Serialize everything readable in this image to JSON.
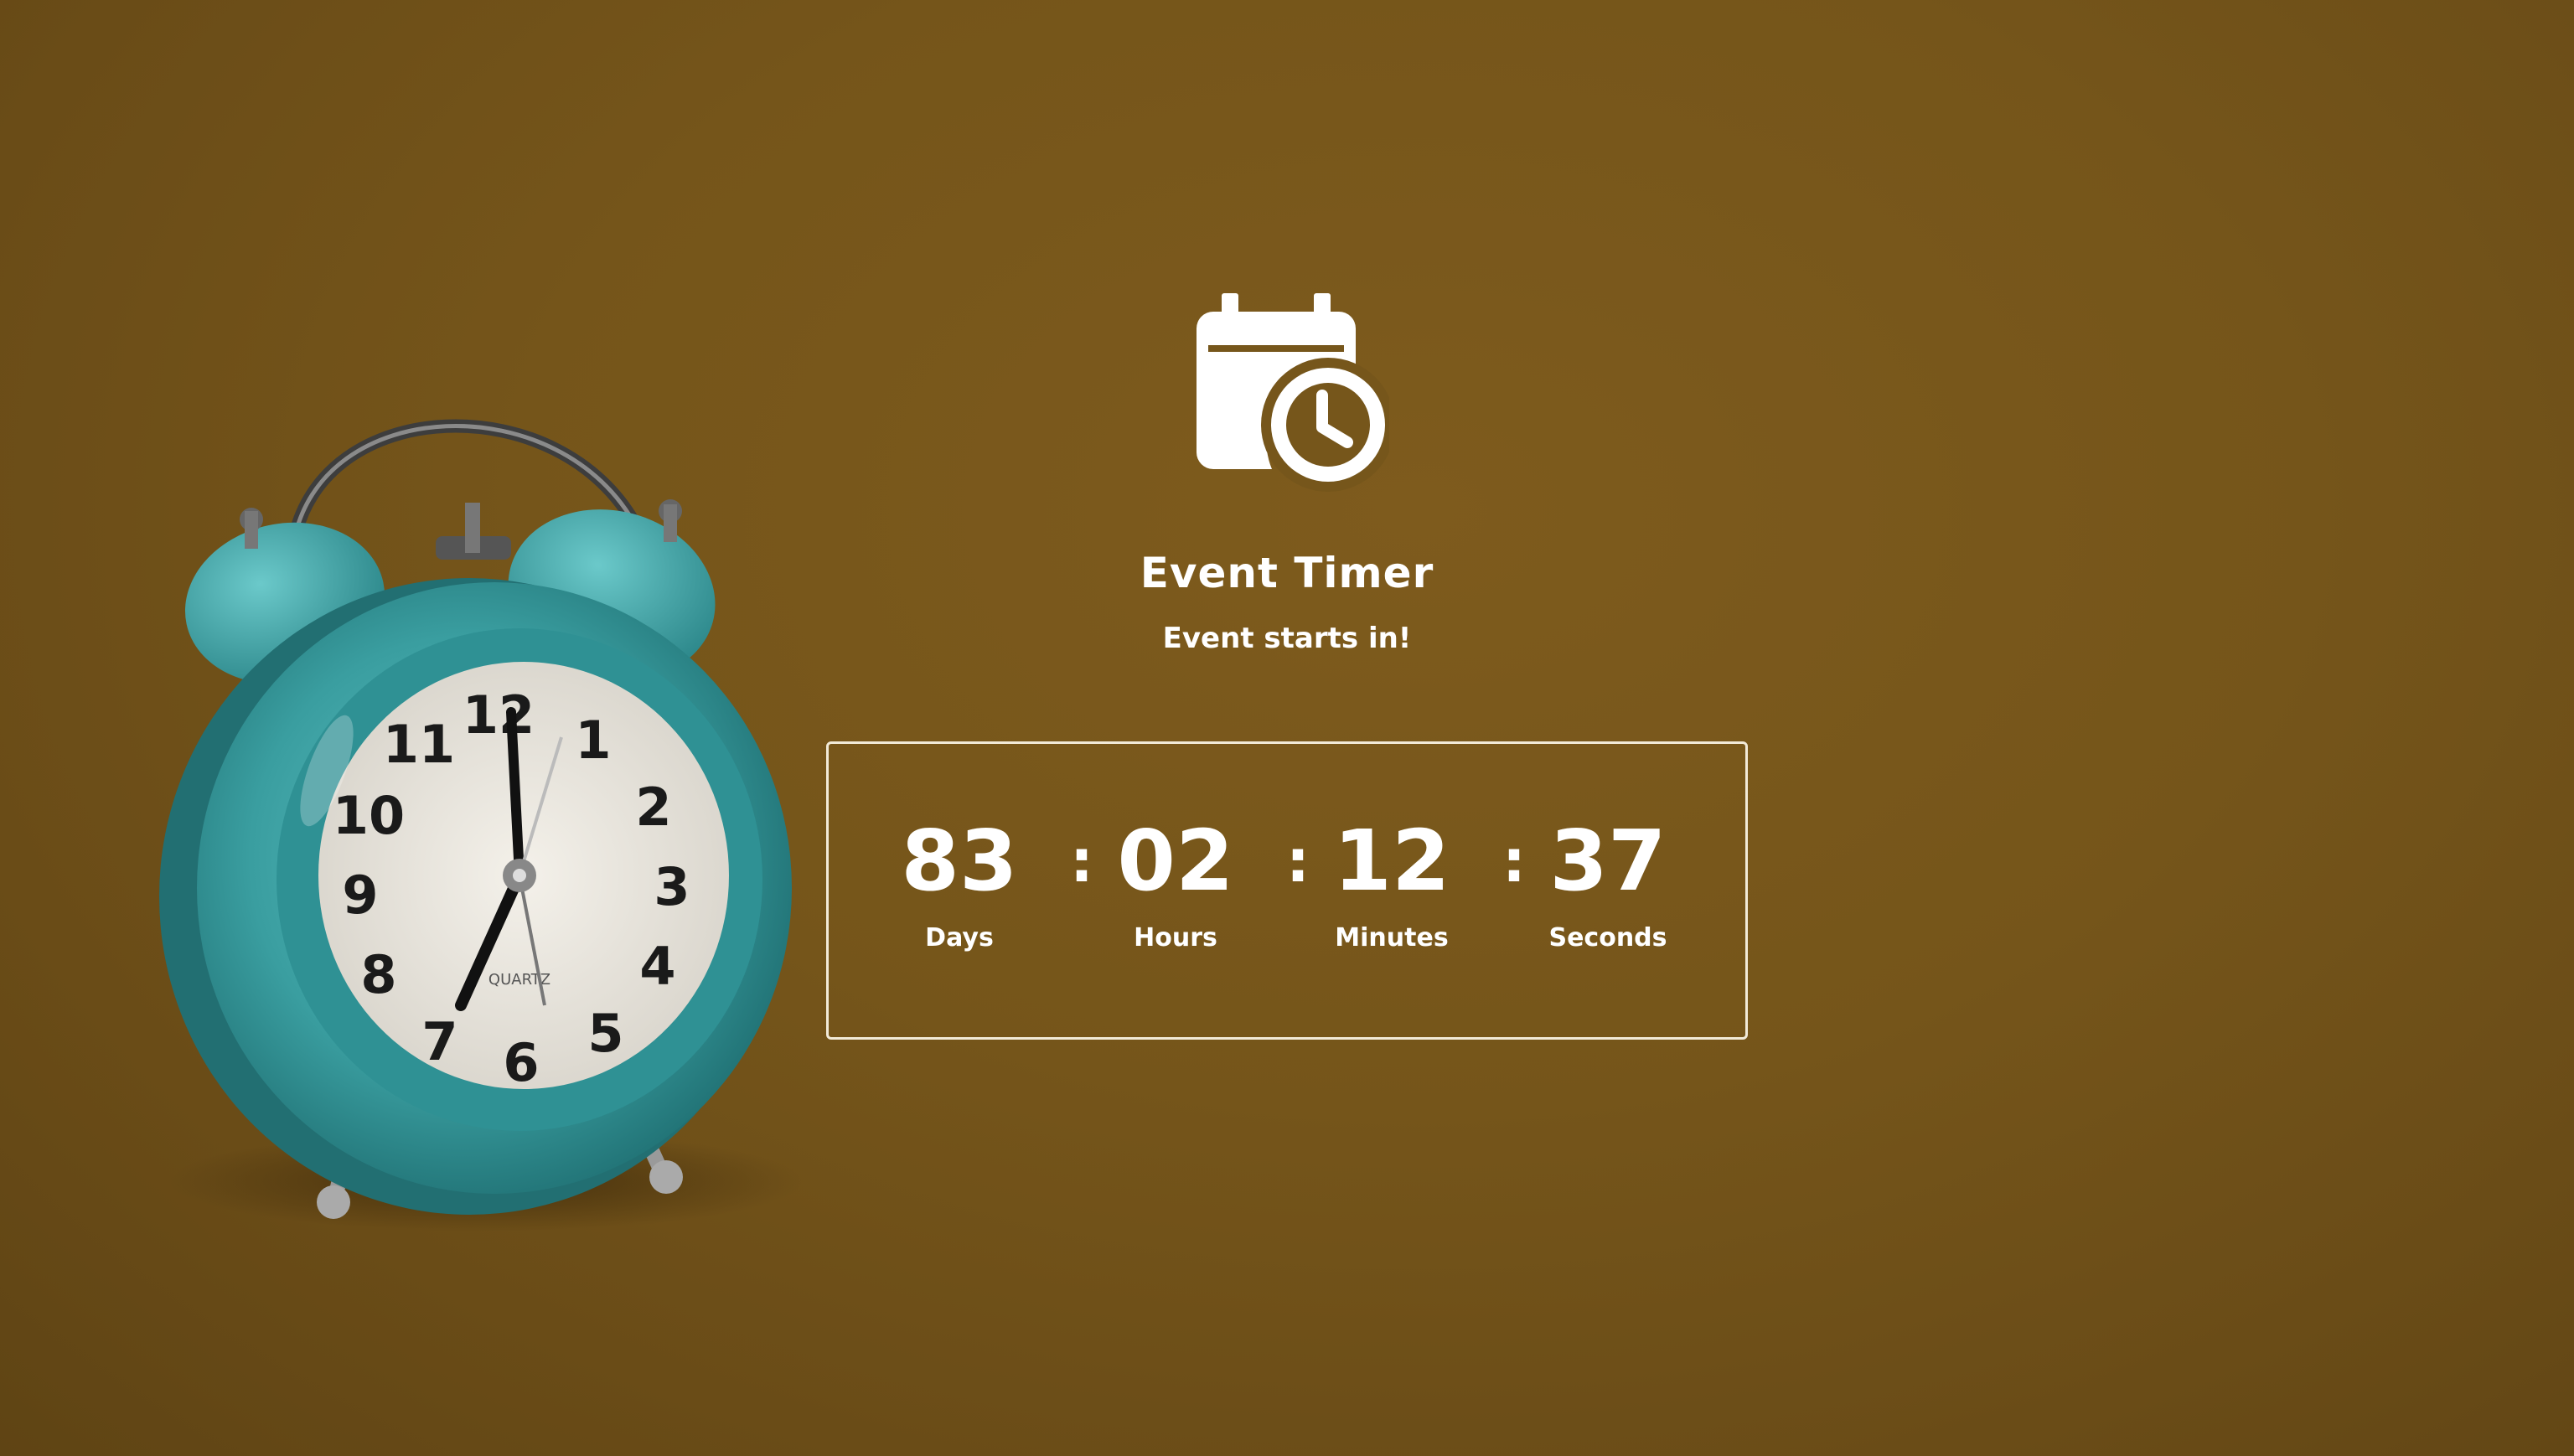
{
  "header": {
    "icon": "calendar-clock-icon",
    "title": "Event Timer",
    "subtitle": "Event starts in!"
  },
  "countdown": {
    "separator": ":",
    "days": {
      "value": "83",
      "label": "Days"
    },
    "hours": {
      "value": "02",
      "label": "Hours"
    },
    "minutes": {
      "value": "12",
      "label": "Minutes"
    },
    "seconds": {
      "value": "37",
      "label": "Seconds"
    }
  },
  "background": {
    "image": "teal-alarm-clock",
    "clock_face_text": "QUARTZ",
    "colors": {
      "background": "#76561b",
      "text": "#ffffff",
      "clock_body": "#3a9ea0"
    }
  }
}
